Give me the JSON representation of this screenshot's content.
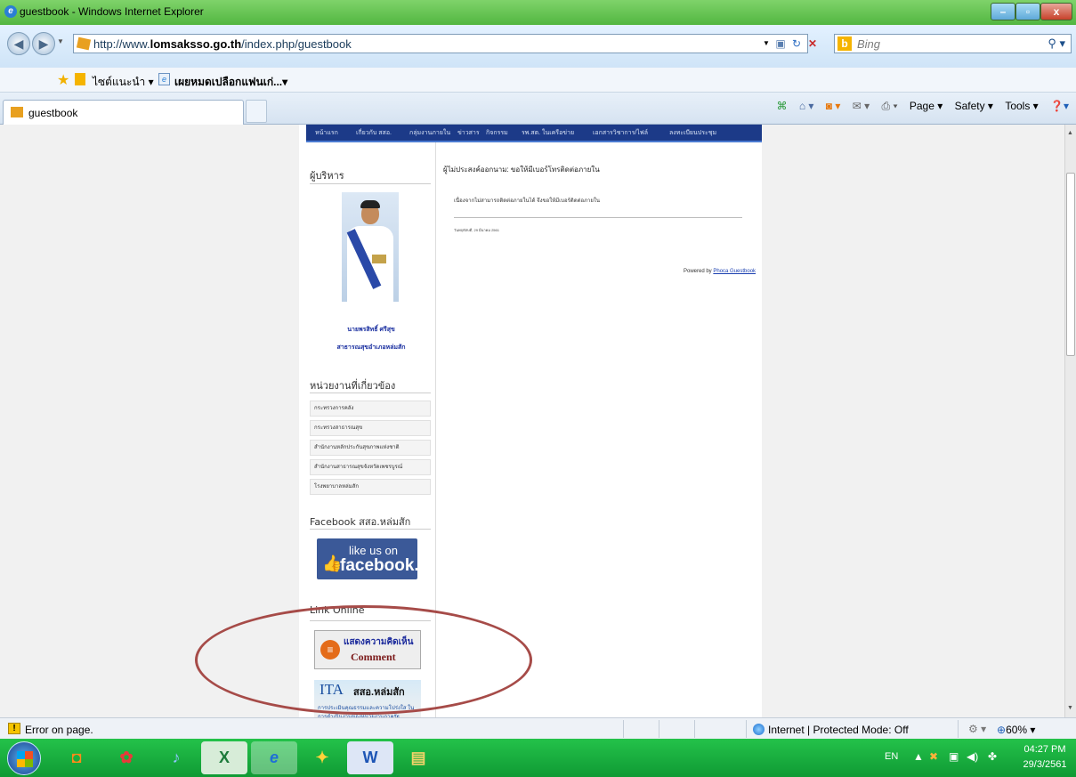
{
  "window": {
    "title": "guestbook - Windows Internet Explorer"
  },
  "address": {
    "url_prefix": "http://www.",
    "url_domain": "lomsaksso.go.th",
    "url_path": "/index.php/guestbook"
  },
  "search": {
    "placeholder": "Bing"
  },
  "favorites": {
    "items": [
      "ไซต์แนะนำ ▾",
      "เผยหมดเปลือกแฟนเก่...▾"
    ]
  },
  "tab": {
    "label": "guestbook"
  },
  "commandbar": {
    "page": "Page ▾",
    "safety": "Safety ▾",
    "tools": "Tools ▾"
  },
  "site": {
    "nav": [
      "หน้าแรก",
      "เกี่ยวกับ สสอ.",
      "กลุ่มงานภายใน",
      "ข่าวสาร",
      "กิจกรรม",
      "รพ.สต. ในเครือข่าย",
      "เอกสารวิชาการ/ไฟล์",
      "ลงทะเบียนประชุม"
    ],
    "sidebar": {
      "admin_heading": "ผู้บริหาร",
      "name": "นายพรสิทธิ์ ศรีสุข",
      "position": "สาธารณสุขอำเภอหล่มสัก",
      "related_heading": "หน่วยงานที่เกี่ยวข้อง",
      "links": [
        "กระทรวงการคลัง",
        "กระทรวงสาธารณสุข",
        "สำนักงานหลักประกันสุขภาพแห่งชาติ",
        "สำนักงานสาธารณสุขจังหวัดเพชรบูรณ์",
        "โรงพยาบาลหล่มสัก"
      ],
      "facebook_heading": "Facebook สสอ.หล่มสัก",
      "fb_line1": "like us on",
      "fb_line2": "facebook.",
      "online_heading": "Link Online",
      "comment_line1": "แสดงความคิดเห็น",
      "comment_line2": "Comment",
      "ita_line1": "ITA",
      "ita_line2": "สสอ.หล่มสัก",
      "ita_line3": "การประเมินคุณธรรมและความโปร่งใส ในการดำเนินงานของหน่วยงานภาครัฐ"
    },
    "main": {
      "heading": "ผู้ไม่ประสงค์ออกนาม: ขอให้มีเบอร์โทรติดต่อภายใน",
      "body": "เนื่องจากไม่สามารถติดต่อภายในได้ จึงขอให้มีเบอร์ติดต่อภายใน",
      "date": "วันพฤหัสบดี, 29 มีนาคม 2561",
      "powered_prefix": "Powered by ",
      "powered_link": "Phoca Guestbook"
    }
  },
  "status": {
    "error": "Error on page.",
    "zone": "Internet | Protected Mode: Off",
    "zoom": "60% ▾"
  },
  "taskbar": {
    "lang": "EN",
    "time": "04:27 PM",
    "date": "29/3/2561"
  }
}
